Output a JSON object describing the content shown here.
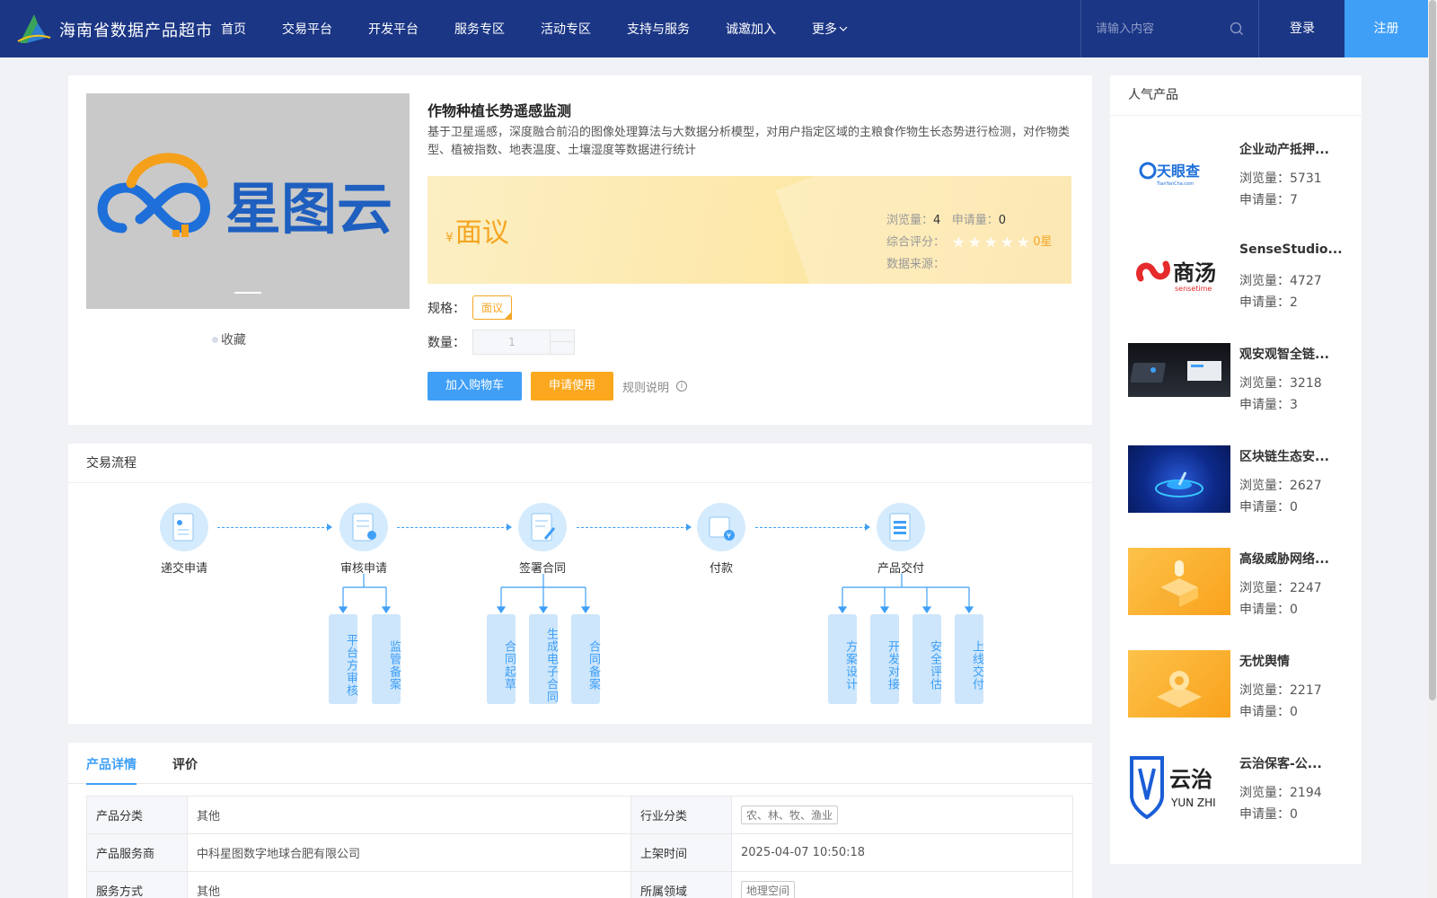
{
  "header": {
    "site_name": "海南省数据产品超市",
    "nav": [
      "首页",
      "交易平台",
      "开发平台",
      "服务专区",
      "活动专区",
      "支持与服务",
      "诚邀加入"
    ],
    "nav_more": "更多",
    "search_placeholder": "请输入内容",
    "login_label": "登录",
    "register_label": "注册"
  },
  "product": {
    "image_brand_text": "星图云",
    "favorite_label": "收藏",
    "title": "作物种植长势遥感监测",
    "description": "基于卫星遥感，深度融合前沿的图像处理算法与大数据分析模型，对用户指定区域的主粮食作物生长态势进行检测，对作物类型、植被指数、地表温度、土壤湿度等数据进行统计",
    "currency": "¥",
    "price": "面议",
    "views_label": "浏览量：",
    "views": "4",
    "applies_label": "申请量：",
    "applies": "0",
    "rating_label": "综合评分：",
    "rating_text": "0星",
    "rating_stars_filled": 0,
    "source_label": "数据来源：",
    "spec_label": "规格：",
    "spec_value": "面议",
    "qty_label": "数量：",
    "qty_value": "1",
    "add_cart_label": "加入购物车",
    "apply_label": "申请使用",
    "rule_label": "规则说明"
  },
  "flow": {
    "title": "交易流程",
    "steps": [
      "递交申请",
      "审核申请",
      "签署合同",
      "付款",
      "产品交付"
    ],
    "sub_steps": {
      "review": [
        "平台方审核",
        "监管备案"
      ],
      "contract": [
        "合同起草",
        "生成电子合同",
        "合同备案"
      ],
      "delivery": [
        "方案设计",
        "开发对接",
        "安全评估",
        "上线交付"
      ]
    }
  },
  "details": {
    "tabs": [
      "产品详情",
      "评价"
    ],
    "active_tab": "产品详情",
    "rows": [
      {
        "k1": "产品分类",
        "v1": "其他",
        "k2": "行业分类",
        "v2": "农、林、牧、渔业"
      },
      {
        "k1": "产品服务商",
        "v1": "中科星图数字地球合肥有限公司",
        "k2": "上架时间",
        "v2": "2025-04-07 10:50:18"
      },
      {
        "k1": "服务方式",
        "v1": "其他",
        "k2": "所属领域",
        "v2": "地理空间"
      }
    ]
  },
  "popular": {
    "title": "人气产品",
    "views_label": "浏览量：",
    "applies_label": "申请量：",
    "items": [
      {
        "name": "企业动产抵押...",
        "views": "5731",
        "applies": "7",
        "logo_text": "天眼查",
        "logo_sub": "TianYanCha.com"
      },
      {
        "name": "SenseStudio...",
        "views": "4727",
        "applies": "2",
        "logo_text": "商汤",
        "logo_sub": "sensetime"
      },
      {
        "name": "观安观智全链...",
        "views": "3218",
        "applies": "3"
      },
      {
        "name": "区块链生态安...",
        "views": "2627",
        "applies": "0"
      },
      {
        "name": "高级威胁网络...",
        "views": "2247",
        "applies": "0"
      },
      {
        "name": "无忧舆情",
        "views": "2217",
        "applies": "0"
      },
      {
        "name": "云治保客-公...",
        "views": "2194",
        "applies": "0",
        "logo_text": "云治",
        "logo_sub": "YUN ZHI"
      }
    ]
  },
  "colors": {
    "nav_bg": "#1b3685",
    "accent": "#3f9ff7",
    "orange": "#fba81e",
    "price": "#f5a623"
  }
}
